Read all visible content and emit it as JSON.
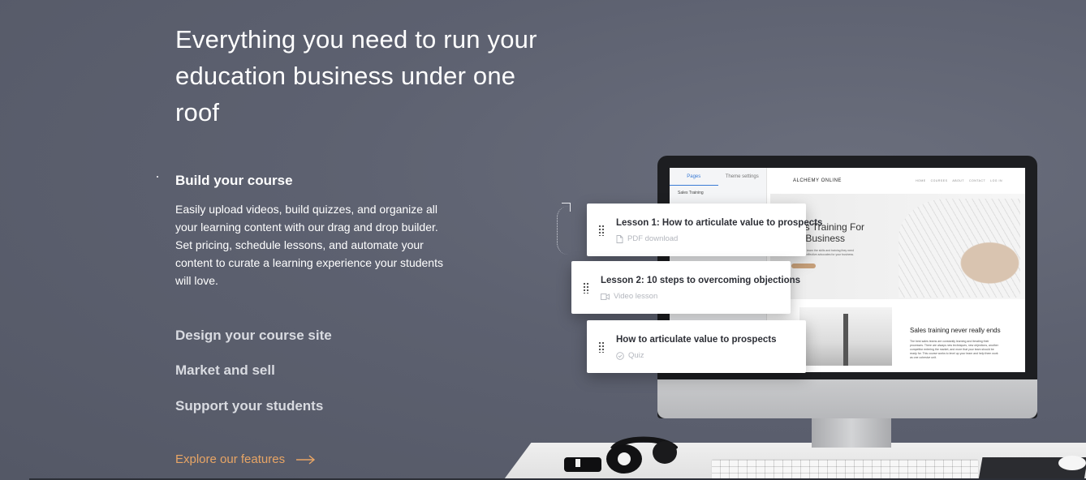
{
  "hero": {
    "headline": "Everything you need to run your education business under one roof"
  },
  "features": {
    "active": {
      "title": "Build your course",
      "description": "Easily upload videos, build quizzes, and organize all your learning content with our drag and drop builder. Set pricing, schedule lessons, and automate your content to curate a learning experience your students will love."
    },
    "items": [
      {
        "label": "Design your course site"
      },
      {
        "label": "Market and sell"
      },
      {
        "label": "Support your students"
      }
    ],
    "cta": "Explore our features"
  },
  "screen": {
    "tabs": [
      "Pages",
      "Theme settings"
    ],
    "sidebar_heading": "Sales Training",
    "site_name": "ALCHEMY ONLINE",
    "nav_links": [
      "HOME",
      "COURSES",
      "ABOUT",
      "CONTACT",
      "LOG IN"
    ],
    "hero_title": "es Training For\nr Business",
    "hero_text": "sales team the skills and training they need\nmost effective advocates for your business.",
    "section_title": "Sales training never really ends",
    "section_text": "The best sales teams are constantly learning and iterating their processes. There are always new techniques, new objections, another competitor entering the market, and more that your team should be ready for. This course works to level up your team and help them work as one cohesive unit."
  },
  "lessons": [
    {
      "title": "Lesson 1: How to articulate value to prospects",
      "type": "PDF download",
      "icon": "document-icon"
    },
    {
      "title": "Lesson 2: 10 steps to overcoming objections",
      "type": "Video lesson",
      "icon": "video-icon"
    },
    {
      "title": "How to articulate value to prospects",
      "type": "Quiz",
      "icon": "quiz-check-icon"
    }
  ],
  "colors": {
    "background": "#5f6371",
    "accent": "#e8a565",
    "text": "#ffffff",
    "muted": "#d9dbe1"
  }
}
